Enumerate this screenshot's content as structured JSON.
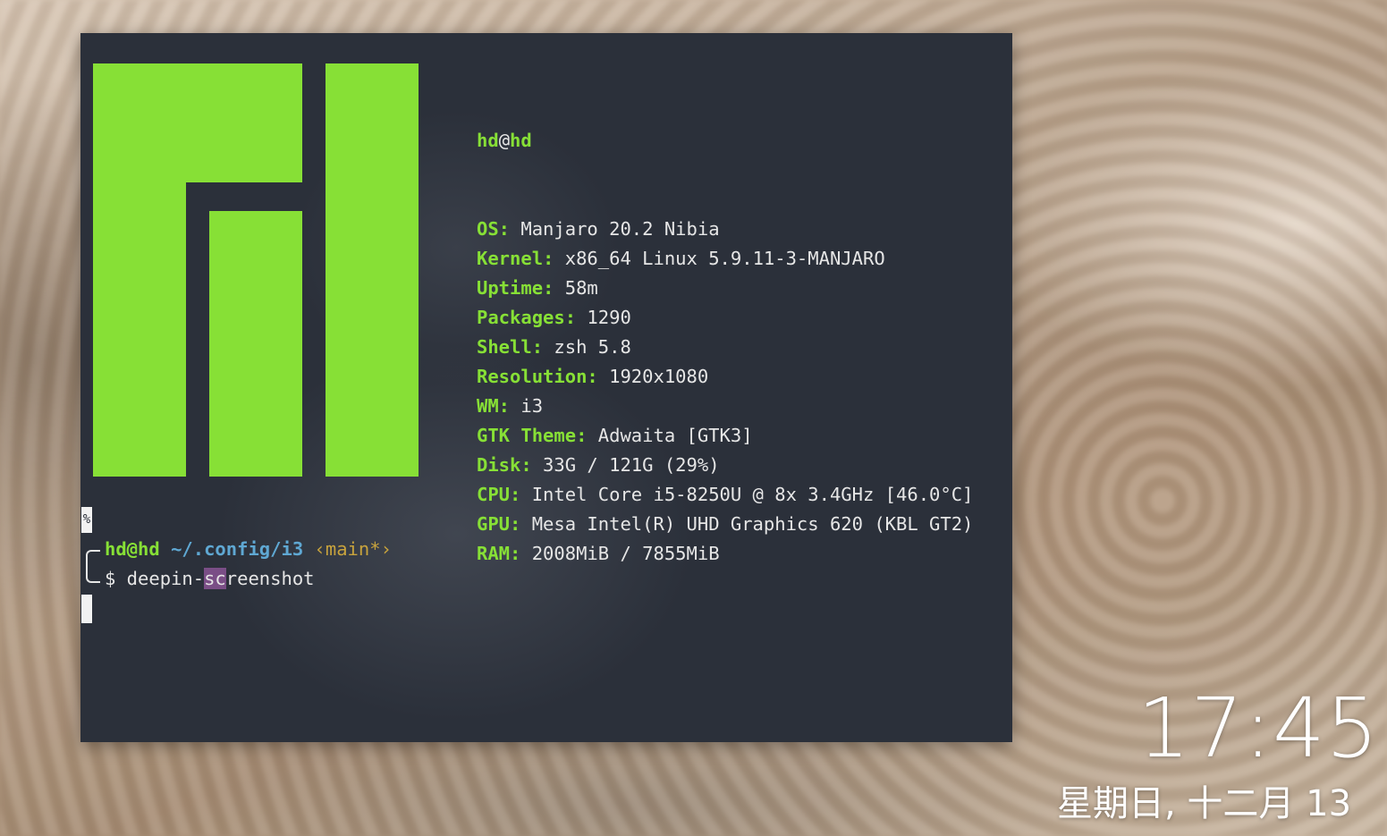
{
  "terminal": {
    "user_host": {
      "user": "hd",
      "at": "@",
      "host": "hd"
    },
    "info_rows": [
      {
        "key": "OS:",
        "value": " Manjaro 20.2 Nibia"
      },
      {
        "key": "Kernel:",
        "value": " x86_64 Linux 5.9.11-3-MANJARO"
      },
      {
        "key": "Uptime:",
        "value": " 58m"
      },
      {
        "key": "Packages:",
        "value": " 1290"
      },
      {
        "key": "Shell:",
        "value": " zsh 5.8"
      },
      {
        "key": "Resolution:",
        "value": " 1920x1080"
      },
      {
        "key": "WM:",
        "value": " i3"
      },
      {
        "key": "GTK Theme:",
        "value": " Adwaita [GTK3]"
      },
      {
        "key": "Disk:",
        "value": " 33G / 121G (29%)"
      },
      {
        "key": "CPU:",
        "value": " Intel Core i5-8250U @ 8x 3.4GHz [46.0°C]"
      },
      {
        "key": "GPU:",
        "value": " Mesa Intel(R) UHD Graphics 620 (KBL GT2)"
      },
      {
        "key": "RAM:",
        "value": " 2008MiB / 7855MiB"
      }
    ],
    "percent_marker": "%",
    "prompt": {
      "user_host": "hd@hd",
      "path": "~/.config/i3",
      "branch": "‹main*›",
      "symbol": "$",
      "cmd_before": " deepin-",
      "cmd_highlight": "sc",
      "cmd_after": "reenshot"
    },
    "logo_color": "#87e036",
    "background_color": "#2b303a"
  },
  "desktop": {
    "clock": "17:45",
    "date": "星期日, 十二月 13"
  }
}
